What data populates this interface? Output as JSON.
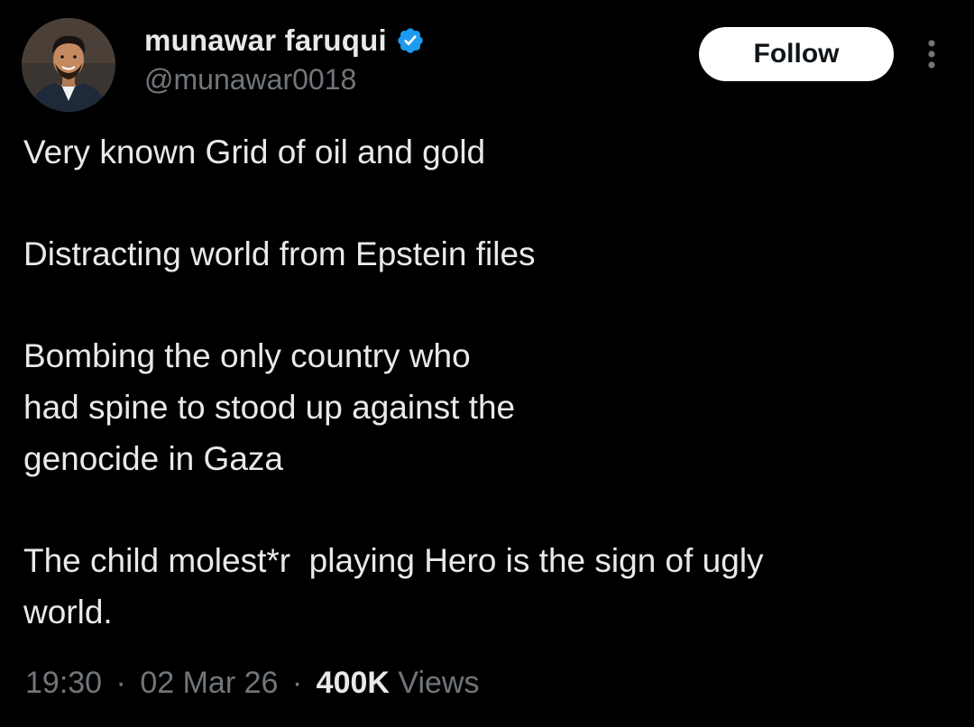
{
  "author": {
    "display_name": "munawar faruqui",
    "handle": "@munawar0018",
    "verified": true
  },
  "actions": {
    "follow_label": "Follow",
    "more_icon": "more-vertical-icon"
  },
  "tweet": {
    "paragraphs": [
      [
        "Very known Grid of oil and gold"
      ],
      [
        "Distracting world from Epstein files"
      ],
      [
        "Bombing the only country who",
        "had spine to stood up against the",
        "genocide in Gaza"
      ],
      [
        "The child molest*r  playing Hero is the sign of ugly",
        "world."
      ]
    ]
  },
  "meta": {
    "time": "19:30",
    "date": "02 Mar 26",
    "views_count": "400K",
    "views_label": "Views",
    "separator": "·"
  },
  "colors": {
    "background": "#000000",
    "text": "#e7e9ea",
    "muted": "#71767b",
    "verified": "#1d9bf0"
  }
}
